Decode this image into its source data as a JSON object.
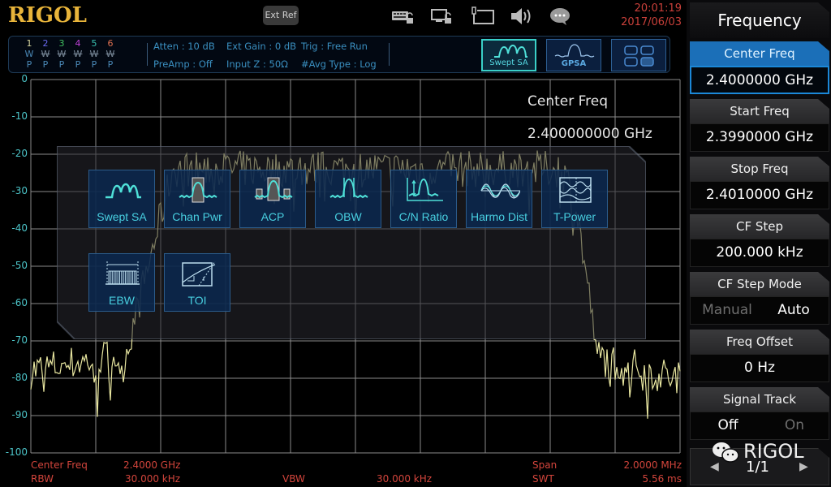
{
  "header": {
    "brand": "RIGOL",
    "ext_ref_label": "Ext Ref",
    "icons": [
      "keyboard-lock-icon",
      "remote-lock-icon",
      "usb-device-icon",
      "speaker-icon",
      "message-icon"
    ],
    "time": "20:01:19",
    "date": "2017/06/03"
  },
  "traces": [
    {
      "num": "1",
      "color": "#d8d8a0",
      "mode": "W",
      "active": true,
      "det": "P"
    },
    {
      "num": "2",
      "color": "#6a6af0",
      "mode": "W",
      "active": false,
      "det": "P"
    },
    {
      "num": "3",
      "color": "#40c060",
      "mode": "W",
      "active": false,
      "det": "P"
    },
    {
      "num": "4",
      "color": "#c040d8",
      "mode": "W",
      "active": false,
      "det": "P"
    },
    {
      "num": "5",
      "color": "#38c0b0",
      "mode": "W",
      "active": false,
      "det": "P"
    },
    {
      "num": "6",
      "color": "#e07050",
      "mode": "W",
      "active": false,
      "det": "P"
    }
  ],
  "status": {
    "atten": "Atten : 10 dB",
    "ext_gain": "Ext Gain : 0 dB",
    "trig": "Trig : Free Run",
    "preamp": "PreAmp : Off",
    "input_z": "Input Z : 50Ω",
    "avg_type": "#Avg Type : Log"
  },
  "modes": [
    {
      "label": "Swept SA",
      "active": true
    },
    {
      "label": "GPSA",
      "active": false
    },
    {
      "label": "",
      "active": false,
      "icon": "grid-menu-icon"
    }
  ],
  "plot": {
    "y_ticks": [
      "0",
      "-10",
      "-20",
      "-30",
      "-40",
      "-50",
      "-60",
      "-70",
      "-80",
      "-90",
      "-100"
    ],
    "readout_label": "Center Freq",
    "readout_value": "2.400000000 GHz"
  },
  "footer": {
    "center_freq_label": "Center Freq",
    "center_freq_value": "2.4000 GHz",
    "span_label": "Span",
    "span_value": "2.0000 MHz",
    "rbw_label": "RBW",
    "rbw_value": "30.000 kHz",
    "vbw_label": "VBW",
    "vbw_value": "30.000 kHz",
    "swt_label": "SWT",
    "swt_value": "5.56 ms"
  },
  "functions": [
    {
      "label": "Swept SA",
      "icon": "swept-sa-icon"
    },
    {
      "label": "Chan Pwr",
      "icon": "chan-pwr-icon"
    },
    {
      "label": "ACP",
      "icon": "acp-icon"
    },
    {
      "label": "OBW",
      "icon": "obw-icon"
    },
    {
      "label": "C/N Ratio",
      "icon": "cn-ratio-icon"
    },
    {
      "label": "Harmo Dist",
      "icon": "harmo-dist-icon"
    },
    {
      "label": "T-Power",
      "icon": "t-power-icon"
    },
    {
      "label": "EBW",
      "icon": "ebw-icon"
    },
    {
      "label": "TOI",
      "icon": "toi-icon"
    }
  ],
  "softkeys": {
    "title": "Frequency",
    "items": [
      {
        "label": "Center Freq",
        "value": "2.4000000 GHz",
        "selected": true
      },
      {
        "label": "Start Freq",
        "value": "2.3990000 GHz"
      },
      {
        "label": "Stop Freq",
        "value": "2.4010000 GHz"
      },
      {
        "label": "CF Step",
        "value": "200.000 kHz"
      },
      {
        "label": "CF Step Mode",
        "opt1": "Manual",
        "opt2": "Auto",
        "active": "Auto"
      },
      {
        "label": "Freq Offset",
        "value": "0 Hz"
      },
      {
        "label": "Signal Track",
        "opt1": "Off",
        "opt2": "On",
        "active": "Off"
      }
    ],
    "page": "1/1",
    "watermark": "RIGOL"
  },
  "trace_colors": {
    "trace": "#e8e6a0",
    "grid": "#8a8a8a",
    "axis_label": "#4cc4c8",
    "footer": "#d3453c"
  }
}
